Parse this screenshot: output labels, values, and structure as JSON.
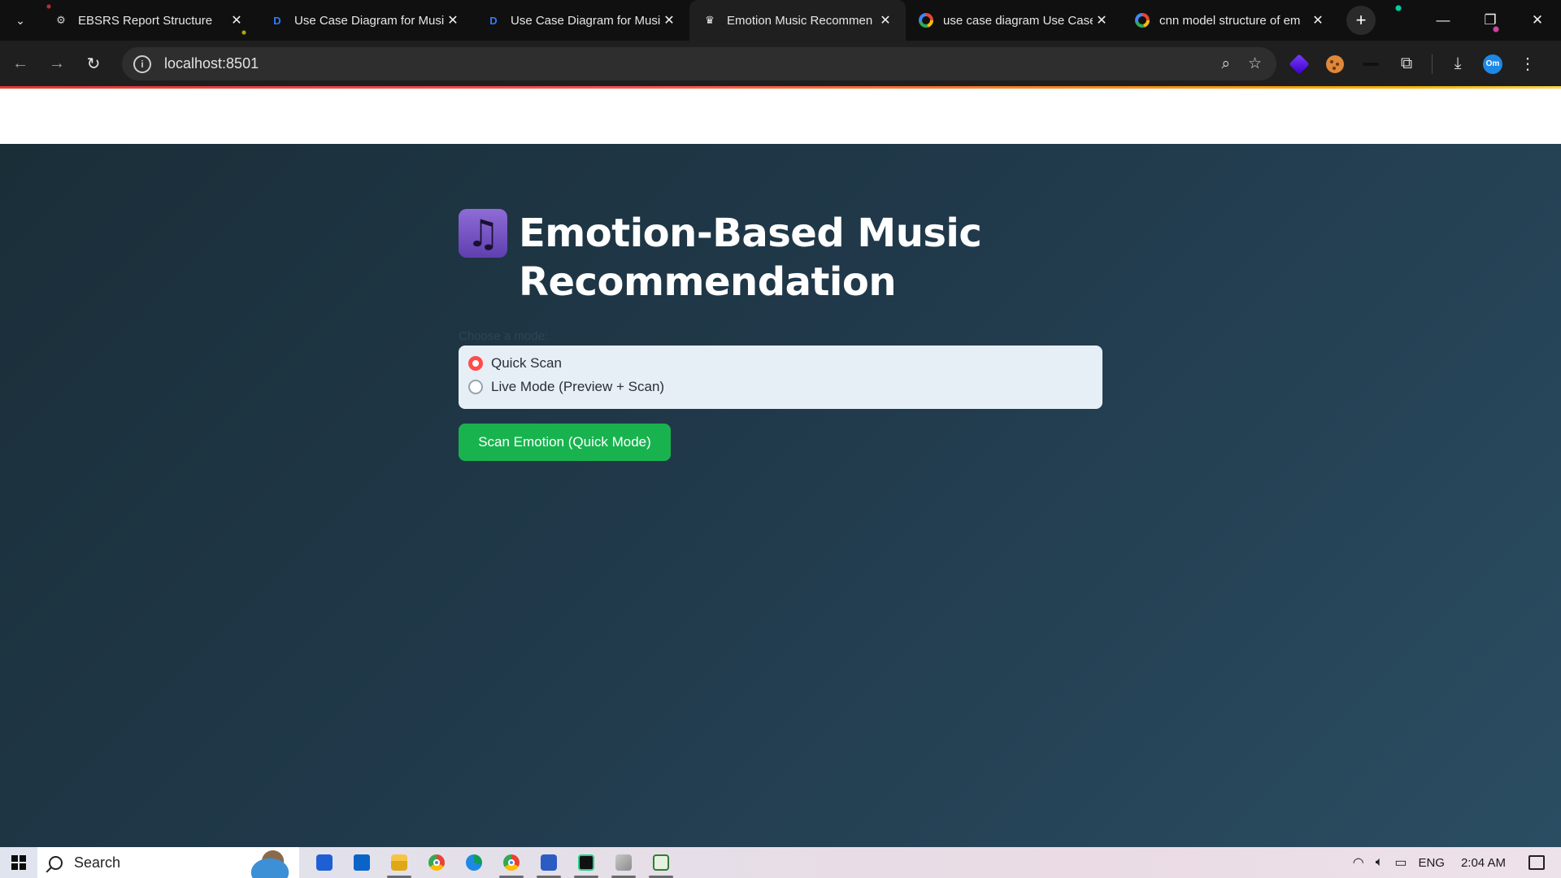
{
  "browser": {
    "tabs": [
      {
        "title": "EBSRS Report Structure",
        "icon": "gear-icon",
        "active": false
      },
      {
        "title": "Use Case Diagram for Musi",
        "icon": "d-logo-icon",
        "active": false
      },
      {
        "title": "Use Case Diagram for Musi",
        "icon": "d-logo-icon",
        "active": false
      },
      {
        "title": "Emotion Music Recommen",
        "icon": "crown-icon",
        "active": true
      },
      {
        "title": "use case diagram Use Case",
        "icon": "google-icon",
        "active": false
      },
      {
        "title": "cnn model structure of em",
        "icon": "google-icon",
        "active": false
      }
    ],
    "close_glyph": "✕",
    "new_tab_glyph": "+",
    "url": "localhost:8501",
    "profile_initials": "Om"
  },
  "app": {
    "title_emoji": "♫",
    "title": "Emotion-Based Music Recommendation",
    "mode_label": "Choose a mode:",
    "options": [
      {
        "label": "Quick Scan",
        "checked": true
      },
      {
        "label": "Live Mode (Preview + Scan)",
        "checked": false
      }
    ],
    "scan_button": "Scan Emotion (Quick Mode)"
  },
  "taskbar": {
    "search_placeholder": "Search",
    "language": "ENG",
    "time": "2:04 AM"
  },
  "colors": {
    "accent_radio": "#ff4b4b",
    "scan_button": "#18b34f",
    "page_background": "#20394a"
  }
}
